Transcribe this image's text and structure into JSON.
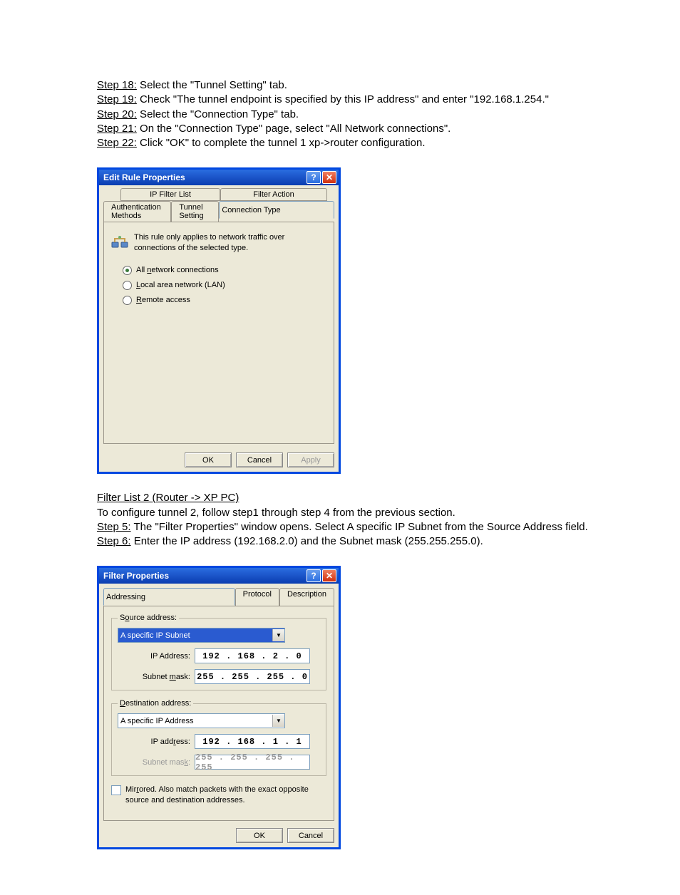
{
  "steps_top": [
    {
      "label": "Step 18:",
      "text": " Select the \"Tunnel Setting\" tab."
    },
    {
      "label": "Step 19:",
      "text": " Check \"The tunnel endpoint is specified by this IP address\" and enter \"192.168.1.254.\""
    },
    {
      "label": "Step 20:",
      "text": " Select the \"Connection Type\" tab."
    },
    {
      "label": "Step 21:",
      "text": " On the \"Connection Type\" page, select \"All Network connections\"."
    },
    {
      "label": "Step 22:",
      "text": " Click \"OK\" to complete the tunnel 1 xp->router configuration."
    }
  ],
  "dlg1": {
    "title": "Edit Rule Properties",
    "tabs_back": {
      "left": "IP Filter List",
      "right": "Filter Action"
    },
    "tabs_front": {
      "left": "Authentication Methods",
      "mid": "Tunnel Setting",
      "right": "Connection Type"
    },
    "info": "This rule only applies to network traffic over connections of the selected type.",
    "radios": [
      {
        "pre": "All ",
        "u": "n",
        "post": "etwork connections",
        "checked": true
      },
      {
        "pre": "",
        "u": "L",
        "post": "ocal area network (LAN)",
        "checked": false
      },
      {
        "pre": "",
        "u": "R",
        "post": "emote access",
        "checked": false
      }
    ],
    "buttons": {
      "ok": "OK",
      "cancel": "Cancel",
      "apply": "Apply"
    }
  },
  "mid_section": {
    "title": "Filter List 2 (Router -> XP PC)",
    "line1": "To configure tunnel 2, follow step1 through step 4 from the previous section.",
    "step5_label": "Step 5:",
    "step5_text": " The \"Filter Properties\" window opens. Select A specific IP Subnet from the Source Address field.",
    "step6_label": "Step 6:",
    "step6_text": " Enter the IP address (192.168.2.0) and the Subnet mask (255.255.255.0)."
  },
  "dlg2": {
    "title": "Filter Properties",
    "tabs": [
      "Addressing",
      "Protocol",
      "Description"
    ],
    "src": {
      "legend_pre": "S",
      "legend_u": "o",
      "legend_post": "urce address:",
      "select": "A specific IP Subnet",
      "ip_label": "IP Address:",
      "ip": "192 . 168 .   2  .   0",
      "mask_label_pre": "Subnet ",
      "mask_label_u": "m",
      "mask_label_post": "ask:",
      "mask": "255 . 255 . 255 .   0"
    },
    "dst": {
      "legend_pre": "",
      "legend_u": "D",
      "legend_post": "estination address:",
      "select": "A specific IP Address",
      "ip_label_pre": "IP add",
      "ip_label_u": "r",
      "ip_label_post": "ess:",
      "ip": "192 . 168 .   1  .   1",
      "mask_label_pre": "Subnet mas",
      "mask_label_u": "k",
      "mask_label_post": ":",
      "mask": "255 . 255 . 255 . 255"
    },
    "mirror_pre": "Mir",
    "mirror_u": "r",
    "mirror_post": "ored. Also match packets with the exact opposite source and destination addresses.",
    "buttons": {
      "ok": "OK",
      "cancel": "Cancel"
    }
  }
}
